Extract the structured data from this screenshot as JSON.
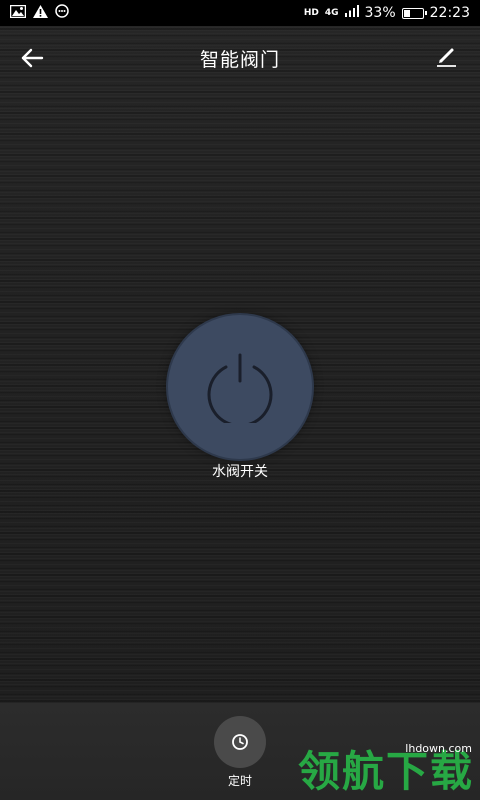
{
  "status_bar": {
    "network_badge": "HD",
    "network_type": "4G",
    "battery_percent": "33%",
    "battery_level": 0.33,
    "time": "22:23"
  },
  "app_bar": {
    "title": "智能阀门"
  },
  "power": {
    "label": "水阀开关"
  },
  "bottom": {
    "timer_label": "定时"
  },
  "watermark": {
    "text": "领航下载",
    "url": "lhdown.com"
  },
  "colors": {
    "power_button": "#3d4a61",
    "watermark": "#27a844",
    "background": "#222222"
  }
}
